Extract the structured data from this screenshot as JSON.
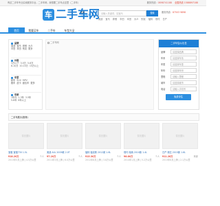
{
  "topbar": {
    "left_text": "有这二手车专业买卖服务平台，二手车网，我想要二手车点这里（二手车）",
    "right_text": "服务热线：",
    "hotline": "0898741188",
    "right_extra": "全国热线 1588897188"
  },
  "header": {
    "logo_mark": "车",
    "logo_text": "二手车网",
    "city_name": "北京",
    "city_switch": "[切换城市]",
    "search_placeholder": "请输入关键词，如宝马",
    "search_button": "搜索",
    "hot_words": [
      "奥迪",
      "宝马",
      "奔驰",
      "丰田",
      "本田",
      "大众",
      "别克",
      "福特",
      "现代",
      "日产"
    ],
    "phone_label": "服务热线：",
    "phone_number": "87503 9898"
  },
  "nav": {
    "items": [
      {
        "label": "首页",
        "active": true
      },
      {
        "label": "我要买车",
        "active": false
      },
      {
        "label": "二手车",
        "active": false
      },
      {
        "label": "车型大全",
        "active": false
      }
    ]
  },
  "filters": [
    {
      "title": "品牌",
      "rows": [
        [
          "奥迪",
          "宝马",
          "奔驰",
          "大众"
        ],
        [
          "丰田",
          "本田",
          "别克",
          "更多"
        ]
      ]
    },
    {
      "title": "价格",
      "rows": [
        [
          "3万以下",
          "3-5万",
          "5-8万"
        ],
        [
          "8-10万",
          "10-15万",
          "15万以上"
        ]
      ]
    },
    {
      "title": "车型",
      "rows": [
        [
          "轿车",
          "SUV",
          "MPV"
        ],
        [
          "跑车",
          "皮卡",
          "面包车",
          "更多"
        ]
      ]
    },
    {
      "title": "车龄",
      "rows": [
        [
          "1年内",
          "1-3年",
          "3-5年"
        ],
        [
          "5-8年",
          "8年以上"
        ]
      ]
    }
  ],
  "banner": {
    "alt_text": "二手车网"
  },
  "sell_form": {
    "title": "二手车估价/出售",
    "fields": [
      {
        "label": "品牌",
        "placeholder": "请选择品牌"
      },
      {
        "label": "车系",
        "placeholder": "请选择车系"
      },
      {
        "label": "车型",
        "placeholder": "请选择车型"
      },
      {
        "label": "年份",
        "placeholder": "请选择年份"
      },
      {
        "label": "里程",
        "placeholder": "请输入里程"
      },
      {
        "label": "城市",
        "placeholder": "请选择城市"
      },
      {
        "label": "电话",
        "placeholder": "请输入手机号"
      }
    ],
    "submit_label": "免费评估"
  },
  "listing": {
    "title": "二手车展示(推荐)",
    "photo_placeholder": "暂无图片",
    "cars": [
      {
        "title": "宝骏 宝骏730 1.5L",
        "price": "¥18.20万",
        "tag": "个人",
        "meta": "2013年5月上牌 | 4.5万公里"
      },
      {
        "title": "奥迪 A4L 2009款 2.0T",
        "price": "¥7.20万",
        "tag": "个人",
        "meta": "2011年3月上牌 | 6.0万公里"
      },
      {
        "title": "福特 福克斯 2012款 1.6L",
        "price": "¥15.30万",
        "tag": "个人",
        "meta": "2012年8月上牌 | 3.8万公里"
      },
      {
        "title": "现代 瑞纳 2010款 1.4L",
        "price": "¥6.80万",
        "tag": "个人",
        "meta": "2014年1月上牌 | 5.2万公里"
      },
      {
        "title": "日产 骐达 2015款 1.6L",
        "price": "¥11.28万",
        "tag": "商家",
        "meta": "2013年6月上牌 | 2.1万公里"
      }
    ]
  },
  "colors": {
    "brand_blue": "#2d8fe0",
    "price_red": "#e64c3c"
  }
}
